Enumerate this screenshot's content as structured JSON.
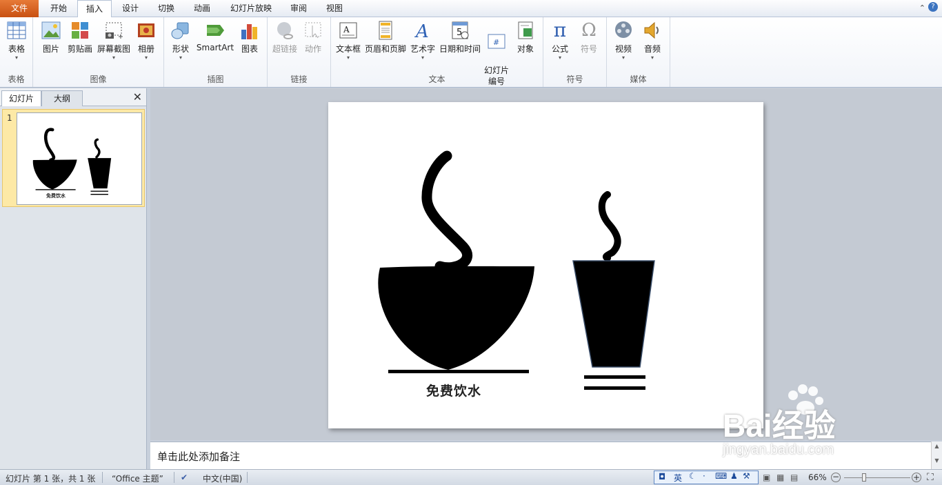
{
  "tabs": [
    "文件",
    "开始",
    "插入",
    "设计",
    "切换",
    "动画",
    "幻灯片放映",
    "审阅",
    "视图"
  ],
  "ribbon": {
    "groups": [
      {
        "label": "表格",
        "buttons": [
          {
            "label": "表格"
          }
        ]
      },
      {
        "label": "图像",
        "buttons": [
          {
            "label": "图片"
          },
          {
            "label": "剪贴画"
          },
          {
            "label": "屏幕截图"
          },
          {
            "label": "相册"
          }
        ]
      },
      {
        "label": "插图",
        "buttons": [
          {
            "label": "形状"
          },
          {
            "label": "SmartArt"
          },
          {
            "label": "图表"
          }
        ]
      },
      {
        "label": "链接",
        "buttons": [
          {
            "label": "超链接"
          },
          {
            "label": "动作"
          }
        ]
      },
      {
        "label": "文本",
        "buttons": [
          {
            "label": "文本框"
          },
          {
            "label": "页眉和页脚"
          },
          {
            "label": "艺术字"
          },
          {
            "label": "日期和时间"
          },
          {
            "label": "幻灯片\n编号"
          },
          {
            "label": "对象"
          }
        ]
      },
      {
        "label": "符号",
        "buttons": [
          {
            "label": "公式"
          },
          {
            "label": "符号"
          }
        ]
      },
      {
        "label": "媒体",
        "buttons": [
          {
            "label": "视频"
          },
          {
            "label": "音频"
          }
        ]
      }
    ]
  },
  "panel": {
    "tabs": [
      "幻灯片",
      "大纲"
    ],
    "slide_number": "1"
  },
  "slide": {
    "caption": "免费饮水"
  },
  "notes": {
    "placeholder": "单击此处添加备注"
  },
  "status": {
    "slide_info": "幻灯片 第 1 张，共 1 张",
    "theme": "“Office 主题”",
    "language": "中文(中国)",
    "ime_label": "英",
    "zoom": "66%"
  },
  "watermark": {
    "brand": "Bai经验",
    "url": "jingyan.baidu.com"
  }
}
